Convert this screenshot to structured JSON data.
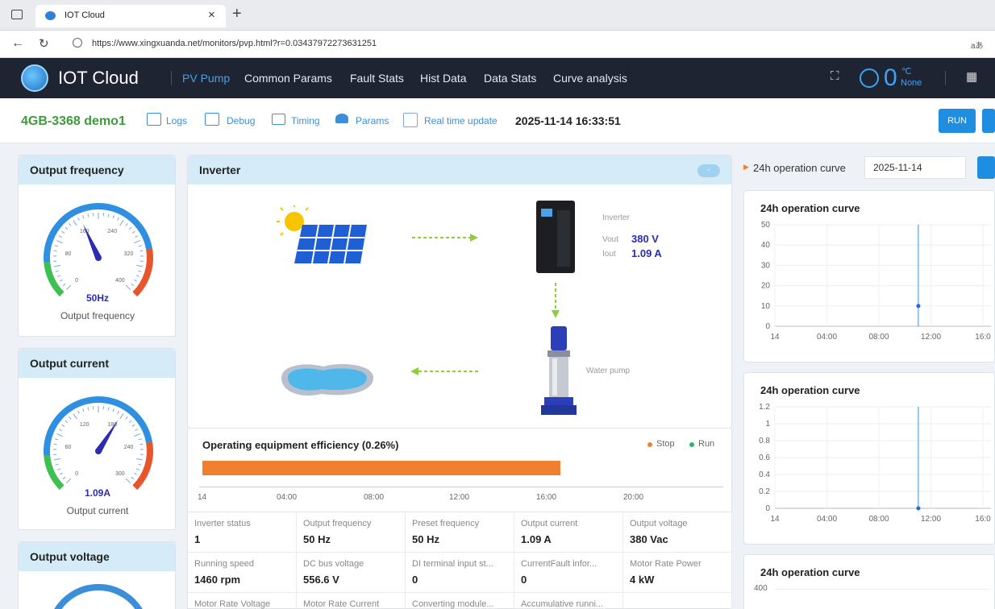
{
  "browser": {
    "tab_title": "IOT Cloud",
    "url": "https://www.xingxuanda.net/monitors/pvp.html?r=0.03437972273631251",
    "a_badge": "aあ"
  },
  "app": {
    "brand": "IOT Cloud",
    "nav": [
      "PV Pump",
      "Common Params",
      "Fault Stats",
      "Hist Data",
      "Data Stats",
      "Curve analysis"
    ],
    "temp_value": "0",
    "temp_unit": "℃",
    "temp_state": "None",
    "accent": "#3ba4f5"
  },
  "device": {
    "name": "4GB-3368 demo1",
    "tools": [
      "Logs",
      "Debug",
      "Timing",
      "Params"
    ],
    "realtime_label": "Real time update",
    "datetime": "2025-11-14 16:33:51",
    "run_label": "RUN"
  },
  "gauges": [
    {
      "title": "Output frequency",
      "value_text": "50Hz",
      "caption": "Output frequency",
      "level": 0.41,
      "ticks": [
        "0",
        "80",
        "160",
        "240",
        "320",
        "400"
      ]
    },
    {
      "title": "Output current",
      "value_text": "1.09A",
      "caption": "Output current",
      "level": 0.62,
      "ticks": [
        "0",
        "60",
        "120",
        "180",
        "240",
        "300"
      ]
    },
    {
      "title": "Output voltage"
    }
  ],
  "inverter": {
    "title": "Inverter",
    "toggle": "-",
    "inv_label": "Inverter",
    "vout_label": "Vout",
    "vout_value": "380 V",
    "iout_label": "Iout",
    "iout_value": "1.09 A",
    "pump_label": "Water pump"
  },
  "efficiency": {
    "title": "Operating equipment efficiency (0.26%)",
    "legend_stop": "Stop",
    "legend_run": "Run",
    "stop_color": "#f08030",
    "run_color": "#2db36b",
    "axis": [
      "14",
      "04:00",
      "08:00",
      "12:00",
      "16:00",
      "20:00"
    ]
  },
  "params": [
    [
      {
        "l": "Inverter status",
        "v": "1"
      },
      {
        "l": "Output frequency",
        "v": "50 Hz"
      },
      {
        "l": "Preset frequency",
        "v": "50 Hz"
      },
      {
        "l": "Output current",
        "v": "1.09 A"
      },
      {
        "l": "Output voltage",
        "v": "380 Vac"
      }
    ],
    [
      {
        "l": "Running speed",
        "v": "1460 rpm"
      },
      {
        "l": "DC bus voltage",
        "v": "556.6 V"
      },
      {
        "l": "DI terminal input st...",
        "v": "0"
      },
      {
        "l": "CurrentFault infor...",
        "v": "0"
      },
      {
        "l": "Motor Rate Power",
        "v": "4 kW"
      }
    ],
    [
      {
        "l": "Motor Rate Voltage",
        "v": ""
      },
      {
        "l": "Motor Rate Current",
        "v": ""
      },
      {
        "l": "Converting module...",
        "v": ""
      },
      {
        "l": "Accumulative runni...",
        "v": ""
      },
      {
        "l": "",
        "v": ""
      }
    ]
  ],
  "right_panel": {
    "header": "24h operation curve",
    "date": "2025-11-14"
  },
  "chart_data": [
    {
      "type": "line",
      "title": "24h operation curve",
      "ylim": [
        0,
        50
      ],
      "yticks": [
        "0",
        "10",
        "20",
        "30",
        "40",
        "50"
      ],
      "xticks": [
        "14",
        "04:00",
        "08:00",
        "12:00",
        "16:0"
      ],
      "series": [
        {
          "x": [
            "16:33"
          ],
          "values": [
            10
          ]
        }
      ]
    },
    {
      "type": "line",
      "title": "24h operation curve",
      "ylim": [
        0,
        1.2
      ],
      "yticks": [
        "0",
        "0.2",
        "0.4",
        "0.6",
        "0.8",
        "1",
        "1.2"
      ],
      "xticks": [
        "14",
        "04:00",
        "08:00",
        "12:00",
        "16:0"
      ],
      "series": [
        {
          "x": [
            "16:33"
          ],
          "values": [
            0
          ]
        }
      ]
    },
    {
      "type": "line",
      "title": "24h operation curve",
      "ylim": [
        0,
        400
      ],
      "yticks": [
        "400"
      ],
      "xticks": [],
      "series": []
    }
  ]
}
